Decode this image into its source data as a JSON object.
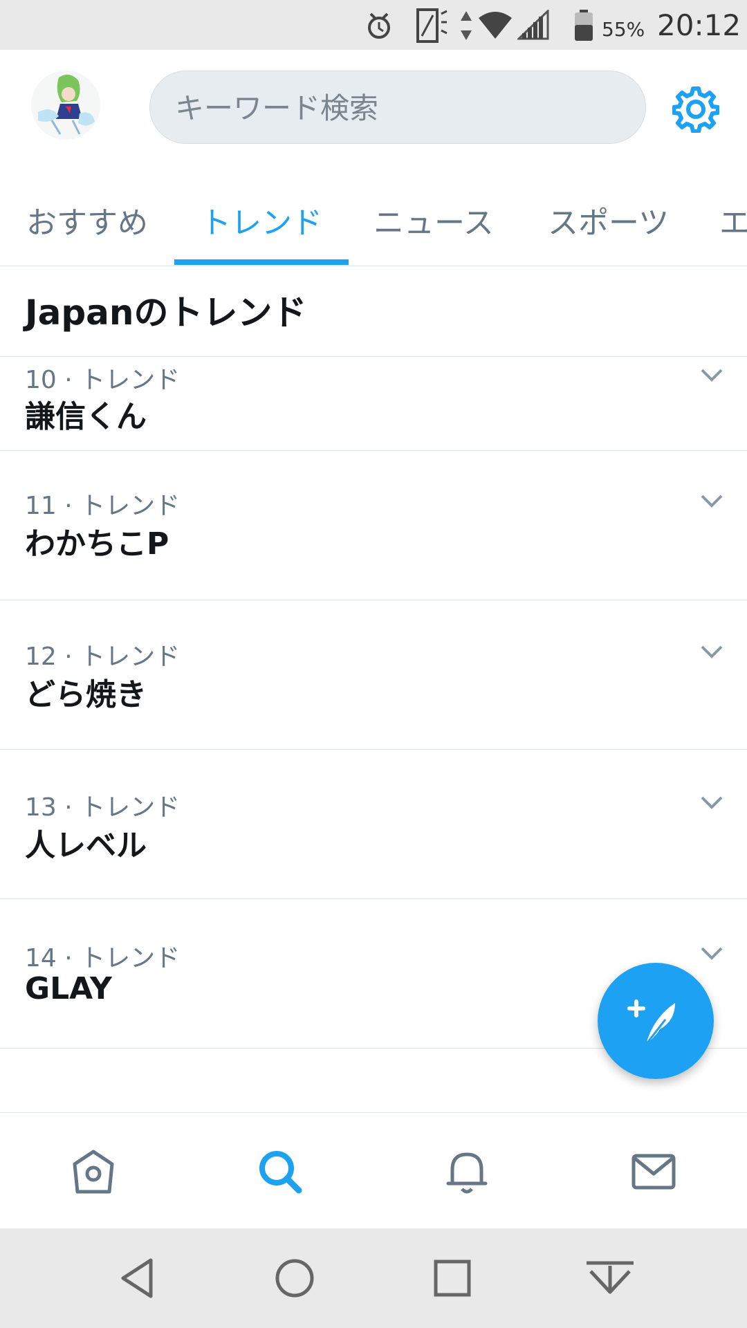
{
  "status_bar": {
    "battery_percent": "55%",
    "time": "20:12"
  },
  "header": {
    "search_placeholder": "キーワード検索"
  },
  "tabs": [
    {
      "label": "おすすめ",
      "active": false
    },
    {
      "label": "トレンド",
      "active": true
    },
    {
      "label": "ニュース",
      "active": false
    },
    {
      "label": "スポーツ",
      "active": false
    },
    {
      "label": "エ",
      "active": false
    }
  ],
  "section": {
    "title": "Japanのトレンド"
  },
  "trends": [
    {
      "meta": "10 · トレンド",
      "name": "謙信くん"
    },
    {
      "meta": "11 · トレンド",
      "name": "わかちこP"
    },
    {
      "meta": "12 · トレンド",
      "name": "どら焼き"
    },
    {
      "meta": "13 · トレンド",
      "name": "人レベル"
    },
    {
      "meta": "14 · トレンド",
      "name": "GLAY"
    }
  ],
  "colors": {
    "accent": "#1da1f2",
    "muted_text": "#657786",
    "primary_text": "#14171a",
    "divider": "#dfe4e8"
  },
  "icons": {
    "status": [
      "alarm-icon",
      "screen-rotate-icon",
      "data-arrows-icon",
      "wifi-icon",
      "signal-icon",
      "battery-icon"
    ],
    "header": [
      "avatar",
      "settings-gear-icon"
    ],
    "bottom_nav": [
      "home-icon",
      "search-icon",
      "notifications-bell-icon",
      "messages-envelope-icon"
    ],
    "android_nav": [
      "back-icon",
      "home-circle-icon",
      "recents-square-icon",
      "notification-pull-icon"
    ],
    "fab": "compose-tweet-icon"
  }
}
